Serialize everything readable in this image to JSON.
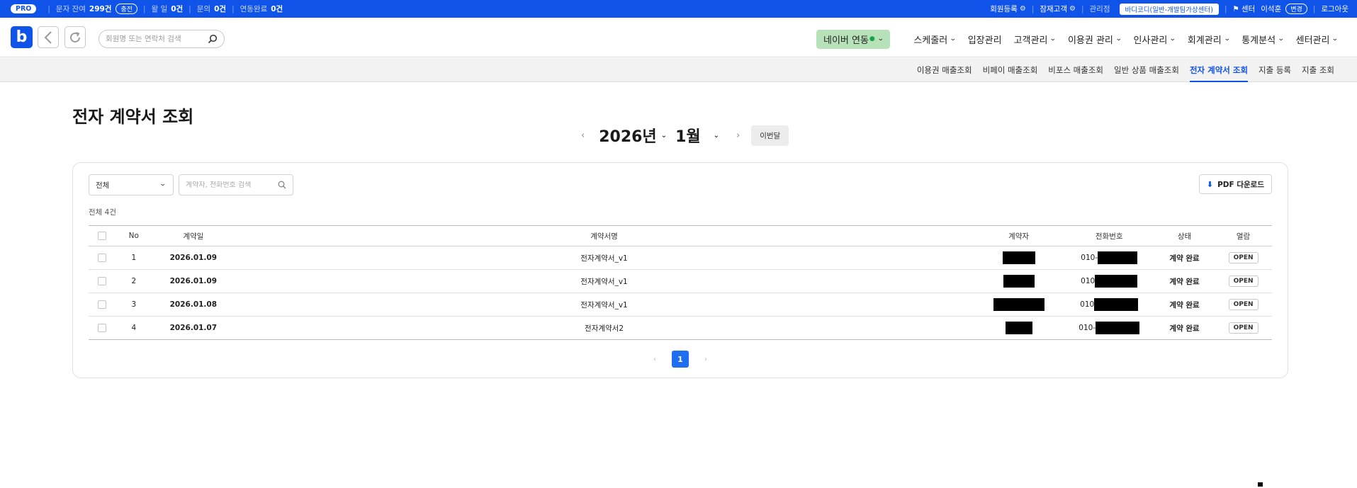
{
  "topbar": {
    "plan_badge": "PRO",
    "sms_label": "문자 잔여",
    "sms_value": "299건",
    "charge_label": "충전",
    "sep": "|",
    "item2_label": "왈 일",
    "item2_value": "0건",
    "inquiry_label": "문의",
    "inquiry_value": "0건",
    "link_done_label": "연동완료",
    "link_done_value": "0건",
    "member_register": "회원등록",
    "potential_customer": "잠재고객",
    "manager_label": "관리점",
    "center_name": "바디코디(일반-개발팀가상센터)",
    "center_flag_label": "센터",
    "user_name": "이석훈",
    "edit_label": "변경",
    "logout": "로그아웃"
  },
  "header": {
    "logo_letter": "b",
    "search_placeholder": "회원명 또는 연락처 검색",
    "naver_label": "네이버 연동",
    "naver_dot": "●",
    "nav_items": [
      {
        "label": "스케줄러",
        "has_chevron": true
      },
      {
        "label": "입장관리",
        "has_chevron": false
      },
      {
        "label": "고객관리",
        "has_chevron": true
      },
      {
        "label": "이용권 관리",
        "has_chevron": true
      },
      {
        "label": "인사관리",
        "has_chevron": true
      },
      {
        "label": "회계관리",
        "has_chevron": true
      },
      {
        "label": "통계분석",
        "has_chevron": true
      },
      {
        "label": "센터관리",
        "has_chevron": true
      }
    ]
  },
  "subnav": {
    "items": [
      {
        "label": "이용권 매출조회"
      },
      {
        "label": "비페이 매출조회"
      },
      {
        "label": "비포스 매출조회"
      },
      {
        "label": "일반 상품 매출조회"
      },
      {
        "label": "전자 계약서 조회"
      },
      {
        "label": "지출 등록"
      },
      {
        "label": "지출 조회"
      }
    ],
    "active_index": 4
  },
  "page": {
    "title": "전자 계약서 조회",
    "year": "2026년",
    "month": "1월",
    "this_month_btn": "이번달",
    "prev_glyph": "‹",
    "next_glyph": "›",
    "chevron_glyph": "⌄"
  },
  "filters": {
    "status_select": "전체",
    "search_placeholder": "계약자, 전화번호 검색",
    "pdf_button": "PDF 다운로드"
  },
  "summary": {
    "total": "전체 4건"
  },
  "table": {
    "columns": [
      "No",
      "계약일",
      "계약서명",
      "계약자",
      "전화번호",
      "상태",
      "열람"
    ],
    "rows": [
      {
        "no": "1",
        "date": "2026.01.09",
        "contract": "전자계약서_v1",
        "phone_prefix": "010-",
        "status": "계약 완료",
        "view": "OPEN"
      },
      {
        "no": "2",
        "date": "2026.01.09",
        "contract": "전자계약서_v1",
        "phone_prefix": "010",
        "status": "계약 완료",
        "view": "OPEN"
      },
      {
        "no": "3",
        "date": "2026.01.08",
        "contract": "전자계약서_v1",
        "phone_prefix": "010",
        "status": "계약 완료",
        "view": "OPEN"
      },
      {
        "no": "4",
        "date": "2026.01.07",
        "contract": "전자계약서2",
        "phone_prefix": "010-",
        "status": "계약 완료",
        "view": "OPEN"
      }
    ]
  },
  "pagination": {
    "current": "1",
    "prev_glyph": "‹",
    "next_glyph": "›"
  },
  "colors": {
    "brand_blue": "#1053e8",
    "naver_green": "#b7e2b9",
    "page_active": "#1d6ef0"
  }
}
